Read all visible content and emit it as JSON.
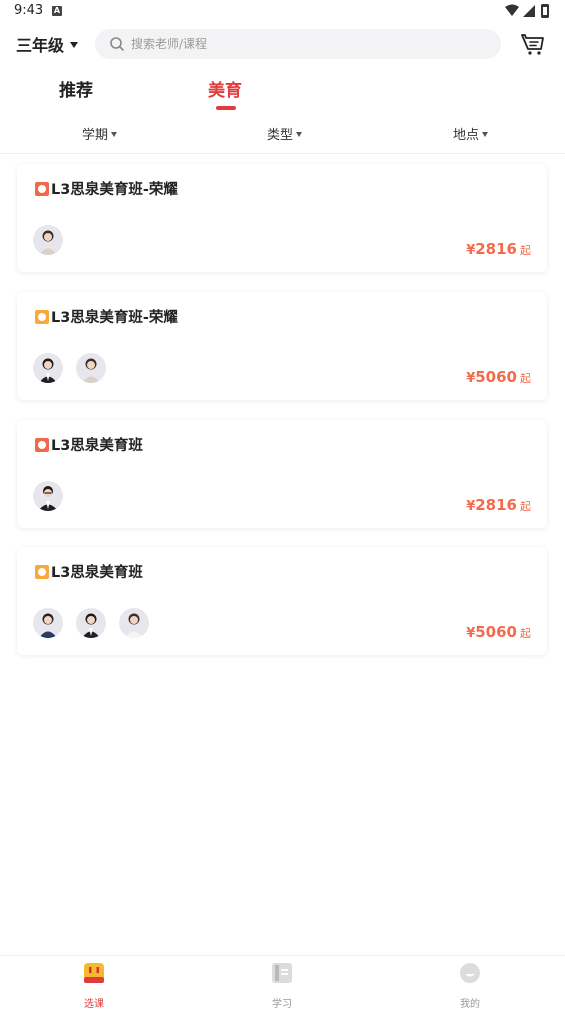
{
  "status_bar": {
    "time": "9:43",
    "notification_label": "A"
  },
  "header": {
    "grade": "三年级",
    "search_placeholder": "搜索老师/课程"
  },
  "tabs": [
    {
      "label": "推荐",
      "active": false
    },
    {
      "label": "美育",
      "active": true
    }
  ],
  "filters": [
    {
      "label": "学期"
    },
    {
      "label": "类型"
    },
    {
      "label": "地点"
    }
  ],
  "courses": [
    {
      "title": "L3思泉美育班-荣耀",
      "badge": "red",
      "price_symbol": "¥",
      "price": "2816",
      "price_suffix": "起",
      "avatar_count": 1
    },
    {
      "title": "L3思泉美育班-荣耀",
      "badge": "orange",
      "price_symbol": "¥",
      "price": "5060",
      "price_suffix": "起",
      "avatar_count": 2
    },
    {
      "title": "L3思泉美育班",
      "badge": "red",
      "price_symbol": "¥",
      "price": "2816",
      "price_suffix": "起",
      "avatar_count": 1
    },
    {
      "title": "L3思泉美育班",
      "badge": "orange",
      "price_symbol": "¥",
      "price": "5060",
      "price_suffix": "起",
      "avatar_count": 3
    }
  ],
  "bottom_nav": [
    {
      "label": "选课",
      "icon": "course-select-icon",
      "active": true
    },
    {
      "label": "学习",
      "icon": "study-icon",
      "active": false
    },
    {
      "label": "我的",
      "icon": "profile-icon",
      "active": false
    }
  ],
  "colors": {
    "accent": "#e33b3b",
    "price": "#f26b4d",
    "badge_red": "#f0694c",
    "badge_orange": "#f7a93b"
  }
}
